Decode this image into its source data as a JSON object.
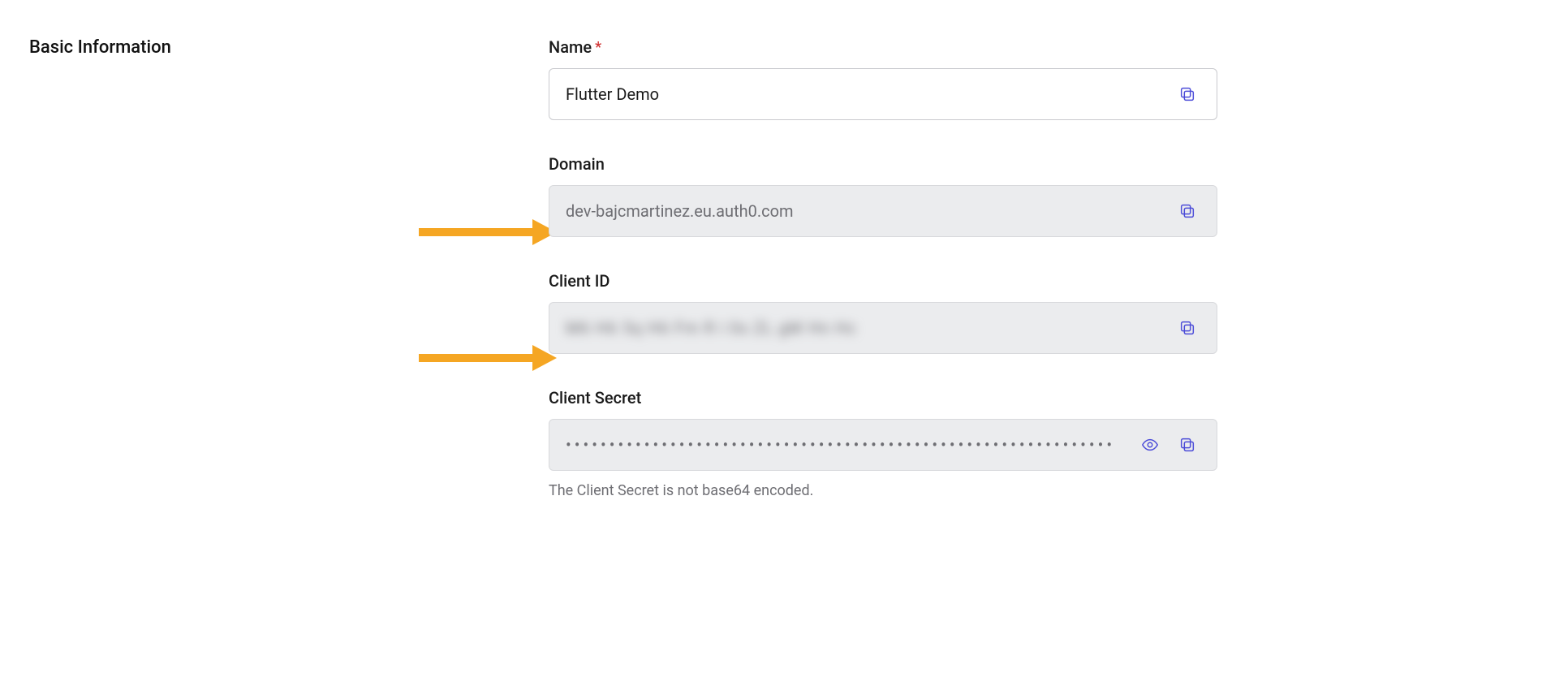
{
  "section_title": "Basic Information",
  "fields": {
    "name": {
      "label": "Name",
      "required_marker": "*",
      "value": "Flutter Demo"
    },
    "domain": {
      "label": "Domain",
      "value": "dev-bajcmartinez.eu.auth0.com"
    },
    "client_id": {
      "label": "Client ID",
      "value_masked": "M6 H6 5q H6 Fm R i 0s ZL gM Hn Hc"
    },
    "client_secret": {
      "label": "Client Secret",
      "value_dots": "•••••••••••••••••••••••••••••••••••••••••••••••••••••••••••••••",
      "help_text": "The Client Secret is not base64 encoded."
    }
  }
}
